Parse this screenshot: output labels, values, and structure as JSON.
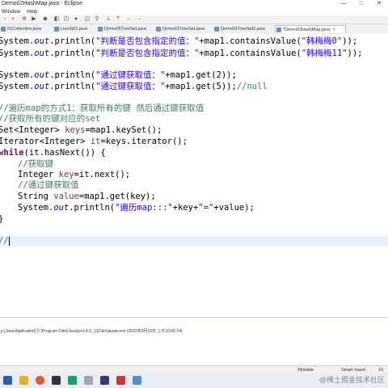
{
  "window": {
    "title": "Demo02HashMap.java - Eclipse",
    "buttons": [
      "—",
      "□",
      "✕"
    ]
  },
  "menu": {
    "items": [
      "Window",
      "Help"
    ]
  },
  "tabs": [
    {
      "label": "01Collection.java"
    },
    {
      "label": "LianXi01.java"
    },
    {
      "label": "Demo05TreeSet.java"
    },
    {
      "label": "Demo01TreeSet.java"
    },
    {
      "label": "Demo01TreeSet2.java"
    },
    {
      "label": "*Demo02HashMap.java",
      "active": true
    }
  ],
  "code": {
    "line1": {
      "pre": "System.",
      "fld": "out",
      "mid": ".println(",
      "str": "\"判断是否包含指定的值：\"",
      "mid2": "+map1.containsValue(",
      "str2": "\"韩梅梅0\"",
      "post": "));"
    },
    "line2": {
      "pre": "System.",
      "fld": "out",
      "mid": ".println(",
      "str": "\"判断是否包含指定的值：\"",
      "mid2": "+map1.containsValue(",
      "str2": "\"韩梅梅11\"",
      "post": "));"
    },
    "line4": {
      "pre": "System.",
      "fld": "out",
      "mid": ".println(",
      "str": "\"通过键获取值：\"",
      "post": "+map1.get(2));"
    },
    "line5": {
      "pre": "System.",
      "fld": "out",
      "mid": ".println(",
      "str": "\"通过键获取值：\"",
      "post": "+map1.get(5));",
      "cmt": "//null"
    },
    "line7": {
      "cmt": "//遍历map的方式1：获取所有的键 然后通过键获取值"
    },
    "line8": {
      "cmt": "//获取所有的键对应的set"
    },
    "line9": {
      "pre": "Set<Integer> ",
      "var": "keys",
      "post": "=map1.keySet();"
    },
    "line10": {
      "pre": "Iterator<Integer> ",
      "var": "it",
      "post": "=keys.iterator();"
    },
    "line11": {
      "kw": "while",
      "post": "(it.hasNext()) {"
    },
    "line12": {
      "cmt": "//获取键"
    },
    "line13": {
      "pre": "Integer ",
      "var": "key",
      "post": "=it.next();"
    },
    "line14": {
      "cmt": "//通过键获取值"
    },
    "line15": {
      "pre": "String ",
      "var": "value",
      "post": "=map1.get(key);"
    },
    "line16": {
      "pre": "System.",
      "fld": "out",
      "mid": ".println(",
      "str": "\"遍历map:::\"",
      "mid2": "+key+",
      "str2": "\"=\"",
      "post": "+value);"
    },
    "line17": {
      "text": "}"
    },
    "line19": {
      "cmt": "//"
    }
  },
  "console": {
    "header": "p [Java Application] C:\\Program Files\\Java\\jre1.8.0_131\\bin\\javaw.exe (2022年9月15日 上午10:06:14)"
  },
  "status": {
    "writable": "Writable",
    "insert": "Smart Insert",
    "position": "10"
  },
  "watermark": "@稀土掘金技术社区",
  "colors": {
    "keyword": "#7f0055",
    "field": "#0000c0",
    "string": "#2a00ff",
    "comment": "#3f7f5f",
    "variable": "#6a3e3e"
  }
}
